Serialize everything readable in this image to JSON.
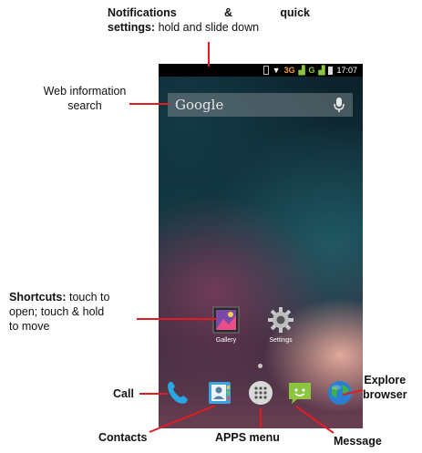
{
  "annotations": {
    "notifications": {
      "bold_words": [
        "Notifications",
        "&",
        "quick"
      ],
      "bold_settings": "settings:",
      "rest": " hold and slide down"
    },
    "web_search": {
      "line1": "Web information",
      "line2": "search"
    },
    "shortcuts": {
      "bold": "Shortcuts:",
      "line1_rest": " touch to",
      "line2": "open; touch & hold",
      "line3": "to move"
    },
    "call": "Call",
    "contacts": "Contacts",
    "apps_menu": "APPS menu",
    "message": "Message",
    "explore": {
      "line1": "Explore",
      "line2": "browser"
    }
  },
  "phone": {
    "status_bar": {
      "network": "3G",
      "signal": "G",
      "time": "17:07"
    },
    "search": {
      "label": "Google"
    },
    "shortcuts": [
      {
        "label": "Gallery",
        "icon": "gallery-icon"
      },
      {
        "label": "Settings",
        "icon": "settings-gear-icon"
      }
    ],
    "dock": [
      {
        "name": "call",
        "icon": "phone-icon"
      },
      {
        "name": "contacts",
        "icon": "contacts-icon"
      },
      {
        "name": "apps",
        "icon": "apps-grid-icon"
      },
      {
        "name": "messaging",
        "icon": "message-icon"
      },
      {
        "name": "browser",
        "icon": "globe-icon"
      }
    ]
  },
  "colors": {
    "leader": "#e31b23",
    "status_network": "#f0a030",
    "status_signal": "#8cc63f"
  }
}
